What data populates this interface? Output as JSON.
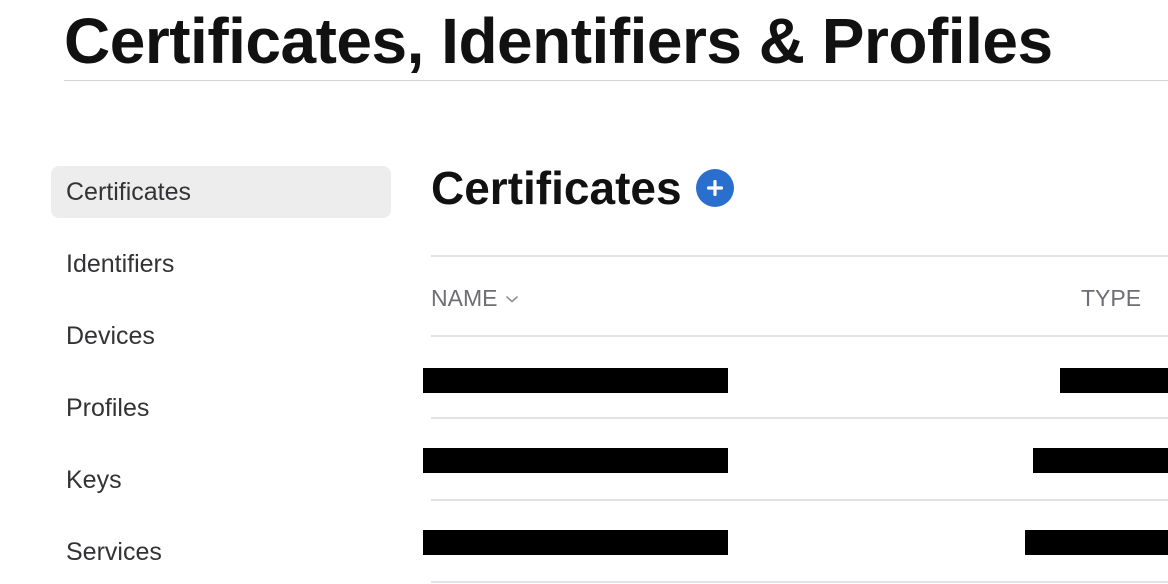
{
  "page": {
    "title": "Certificates, Identifiers & Profiles"
  },
  "sidebar": {
    "active_index": 0,
    "items": [
      {
        "label": "Certificates"
      },
      {
        "label": "Identifiers"
      },
      {
        "label": "Devices"
      },
      {
        "label": "Profiles"
      },
      {
        "label": "Keys"
      },
      {
        "label": "Services"
      }
    ]
  },
  "main": {
    "section_title": "Certificates",
    "add_icon": "plus-circle-icon",
    "table": {
      "columns": {
        "name": "NAME",
        "type": "TYPE"
      },
      "sort_icon": "chevron-down-icon",
      "rows_redacted": true
    }
  },
  "colors": {
    "accent": "#2b6fce",
    "active_bg": "#ededed",
    "divider": "#e2e2e6",
    "redaction": "#000000"
  }
}
